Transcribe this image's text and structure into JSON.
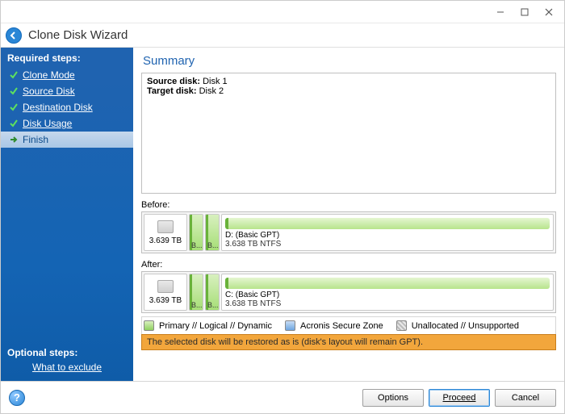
{
  "window": {
    "title": "Clone Disk Wizard"
  },
  "sidebar": {
    "required_title": "Required steps:",
    "steps": [
      {
        "label": "Clone Mode",
        "done": true
      },
      {
        "label": "Source Disk",
        "done": true
      },
      {
        "label": "Destination Disk",
        "done": true
      },
      {
        "label": "Disk Usage",
        "done": true
      },
      {
        "label": "Finish",
        "current": true
      }
    ],
    "optional_title": "Optional steps:",
    "optional_link": "What to exclude"
  },
  "main": {
    "heading": "Summary",
    "summary": {
      "source_label": "Source disk:",
      "source_value": "Disk 1",
      "target_label": "Target disk:",
      "target_value": "Disk 2"
    },
    "before_label": "Before:",
    "after_label": "After:",
    "before": {
      "drive_size": "3.639 TB",
      "small1": "B...",
      "small2": "B...",
      "part_name": "D: (Basic GPT)",
      "part_size": "3.638 TB  NTFS"
    },
    "after": {
      "drive_size": "3.639 TB",
      "small1": "B...",
      "small2": "B...",
      "part_name": "C: (Basic GPT)",
      "part_size": "3.638 TB  NTFS"
    },
    "legend": {
      "primary": "Primary // Logical // Dynamic",
      "secure": "Acronis Secure Zone",
      "unalloc": "Unallocated // Unsupported"
    },
    "notice": "The selected disk will be restored as is (disk's layout will remain GPT)."
  },
  "footer": {
    "options": "Options",
    "proceed": "Proceed",
    "cancel": "Cancel"
  }
}
